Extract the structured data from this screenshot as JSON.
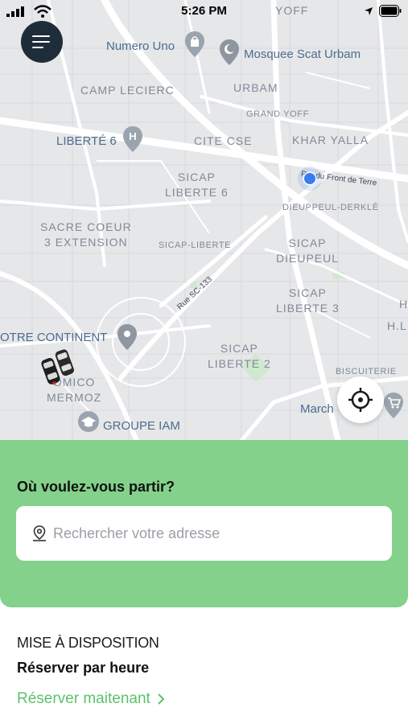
{
  "status_bar": {
    "time": "5:26 PM"
  },
  "map": {
    "labels": {
      "yoff": "YOFF",
      "numero_uno": "Numero Uno",
      "mosquee": "Mosquee Scat Urbam",
      "camp_leclerc": "CAMP LECIERC",
      "urbam": "URBAM",
      "grand_yoff": "GRAND YOFF",
      "liberte6_poi": "LIBERTÉ 6",
      "cite_cse": "CITE CSE",
      "khar_yalla": "KHAR YALLA",
      "rte_front": "Rte du Front de Terre",
      "sicap_liberte6": "SICAP\nLIBERTE 6",
      "dieuppeul_derkle": "DIEUPPEUL-DERKLÉ",
      "sacre_coeur": "SACRE COEUR\n3 EXTENSION",
      "sicap_liberte": "SICAP-LIBERTE",
      "sicap_dieupeul": "SICAP\nDIEUPEUL",
      "rue_sc133": "Rue SC-133",
      "sicap_liberte3": "SICAP\nLIBERTE 3",
      "notre_continent": "OTRE CONTINENT",
      "h": "H",
      "hl": "H.L",
      "sicap_liberte2": "SICAP\nLIBERTE 2",
      "biscuiterie": "BISCUITERIE",
      "comico": "OMICO\nMERMOZ",
      "march": "March",
      "groupe_iam": "GROUPE IAM"
    }
  },
  "panel": {
    "title": "Où voulez-vous partir?",
    "search_placeholder": "Rechercher votre adresse"
  },
  "section": {
    "label": "MISE À DISPOSITION",
    "title": "Réserver par heure",
    "link": "Réserver maitenant"
  },
  "colors": {
    "accent_green": "#83d18b",
    "link_green": "#5cc26a",
    "menu_dark": "#1f2d3b",
    "location_blue": "#2f6fe8"
  },
  "icons": [
    "menu-icon",
    "crosshair-icon",
    "location-pin-icon",
    "car-icon",
    "chevron-right-icon",
    "signal-icon",
    "wifi-icon",
    "battery-icon"
  ]
}
